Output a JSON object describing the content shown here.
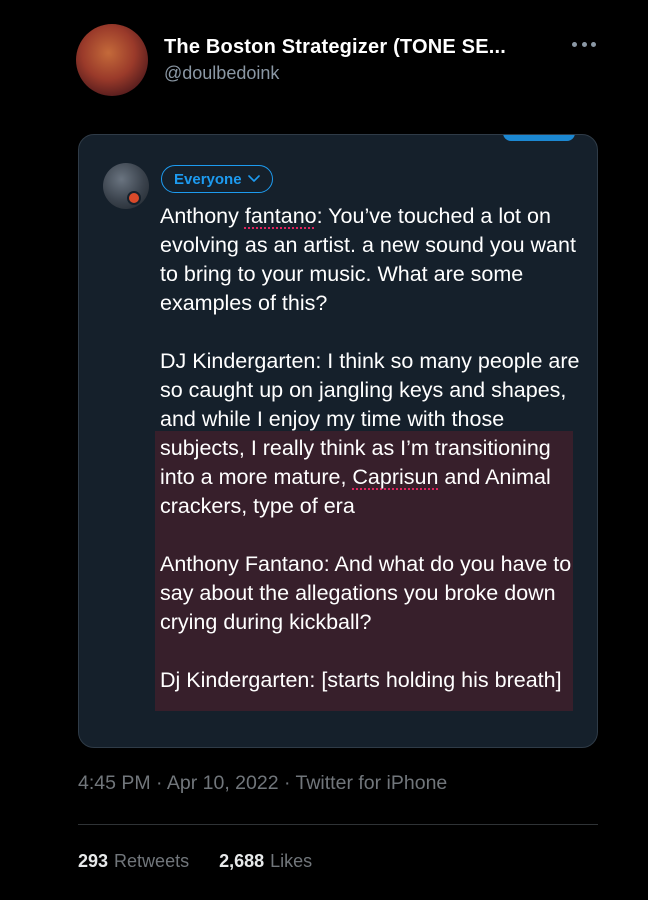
{
  "tweet": {
    "author_name": "The Boston Strategizer (TONE SE...",
    "author_handle": "@doulbedoink",
    "more_icon": "more-horizontal-icon",
    "timestamp": "4:45 PM · Apr 10, 2022 · Twitter for iPhone",
    "retweets_count": "293",
    "retweets_label": "Retweets",
    "likes_count": "2,688",
    "likes_label": "Likes"
  },
  "embedded_screenshot": {
    "audience_label": "Everyone",
    "paragraphs": [
      {
        "pre": "Anthony ",
        "flag": "fantano",
        "post": ": You’ve touched a lot on evolving as an artist. a new sound you want to bring to your music. What are some examples of this?"
      },
      {
        "pre": "DJ Kindergarten: I think so many people are so caught up on jangling keys and shapes, and while I enjoy my time with those subjects, I really think as I’m transitioning into a more mature, ",
        "flag": "Caprisun",
        "post": " and Animal crackers, type of era"
      },
      {
        "pre": "Anthony Fantano: And what do you have to say about the allegations you broke down crying during kickball?",
        "flag": "",
        "post": ""
      },
      {
        "pre": "Dj Kindergarten: [starts holding his breath]",
        "flag": "",
        "post": ""
      }
    ]
  },
  "colors": {
    "background": "#000000",
    "accent": "#1d9bf0",
    "embed_background": "#15202b",
    "highlight": "#3b1f2b",
    "muted_text": "#71767b"
  }
}
